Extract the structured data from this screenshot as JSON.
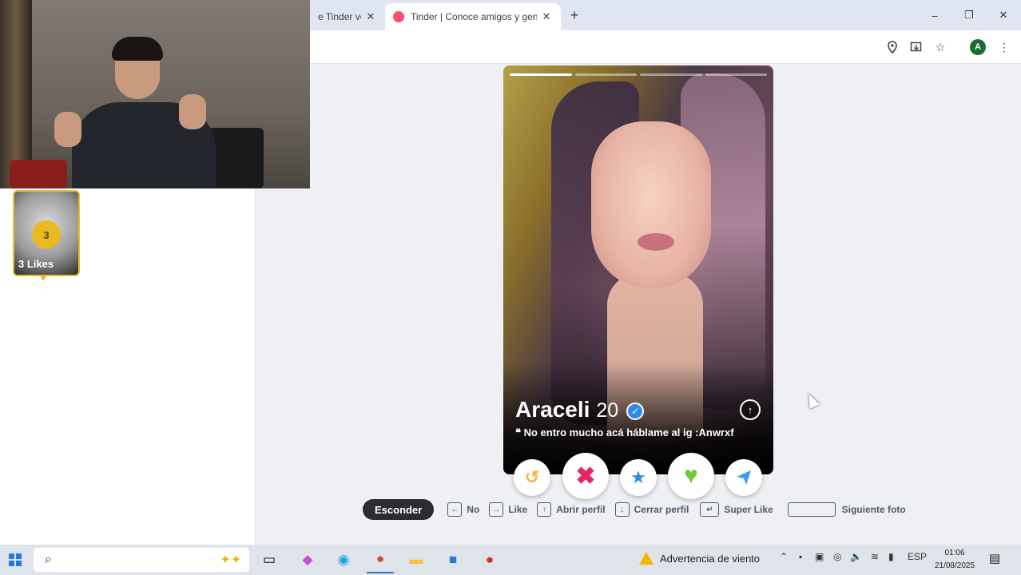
{
  "browser": {
    "tabs": [
      {
        "title": "e Tinder ve",
        "active": false
      },
      {
        "title": "Tinder | Conoce amigos y gente",
        "active": true
      }
    ],
    "new_tab_icon": "plus-icon",
    "window_controls": {
      "minimize": "–",
      "restore": "❐",
      "close": "✕"
    },
    "account_initial": "A"
  },
  "sidebar": {
    "likes": {
      "count": "3",
      "label": "3 Likes"
    }
  },
  "profile": {
    "name": "Araceli",
    "age": "20",
    "verified": true,
    "bio": "No entro mucho acá háblame al ig :Anwrxf",
    "photo_count": 4,
    "current_photo": 1
  },
  "actions": {
    "rewind": "rewind-icon",
    "nope": "nope-icon",
    "super_like": "star-icon",
    "like": "heart-icon",
    "boost": "send-icon"
  },
  "shortcuts": {
    "hide_label": "Esconder",
    "items": [
      {
        "key": "←",
        "label": "No"
      },
      {
        "key": "→",
        "label": "Like"
      },
      {
        "key": "↑",
        "label": "Abrir perfil"
      },
      {
        "key": "↓",
        "label": "Cerrar perfil"
      },
      {
        "key": "↵",
        "label": "Super Like"
      }
    ],
    "space_label": "Siguiente foto"
  },
  "taskbar": {
    "weather": "Advertencia de viento",
    "language": "ESP",
    "time": "01:06",
    "date": "21/08/2025"
  },
  "colors": {
    "nope": "#e8265e",
    "like": "#72c83a",
    "super_like": "#2e8ae6",
    "rewind": "#f5b748",
    "boost": "#3f9be8",
    "likes_gold": "#e8c12e"
  }
}
